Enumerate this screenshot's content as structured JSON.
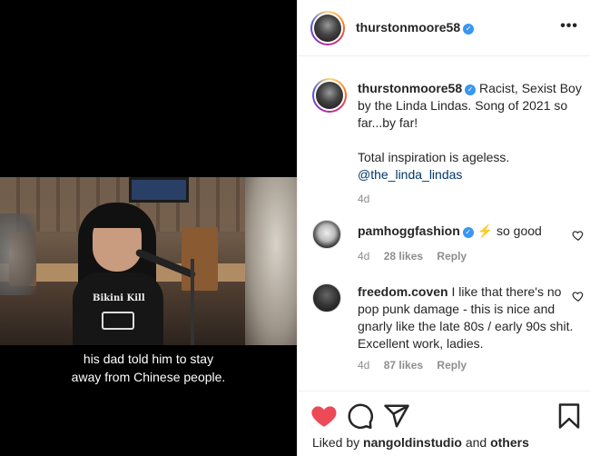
{
  "video": {
    "subtitle_line1": "his dad told him to stay",
    "subtitle_line2": "away from Chinese people.",
    "shirt_text": "Bikini Kill"
  },
  "header": {
    "username": "thurstonmoore58",
    "more_label": "•••"
  },
  "caption": {
    "username": "thurstonmoore58",
    "text_line1": "Racist, Sexist Boy by the Linda Lindas. Song of 2021 so far...by far!",
    "text_line2": "Total inspiration is ageless.",
    "mention": "@the_linda_lindas",
    "time": "4d"
  },
  "comments": [
    {
      "username": "pamhoggfashion",
      "text": "⚡ so good",
      "time": "4d",
      "likes": "28 likes",
      "reply": "Reply"
    },
    {
      "username": "freedom.coven",
      "text": "I like that there's no pop punk damage - this is nice and gnarly like the late 80s / early 90s shit. Excellent work, ladies.",
      "time": "4d",
      "likes": "87 likes",
      "reply": "Reply"
    }
  ],
  "likes": {
    "prefix": "Liked by",
    "user": "nangoldinstudio",
    "joiner": "and",
    "others": "others"
  },
  "colors": {
    "like_red": "#ed4956",
    "verified_blue": "#3897f0",
    "mention_blue": "#00376b"
  }
}
